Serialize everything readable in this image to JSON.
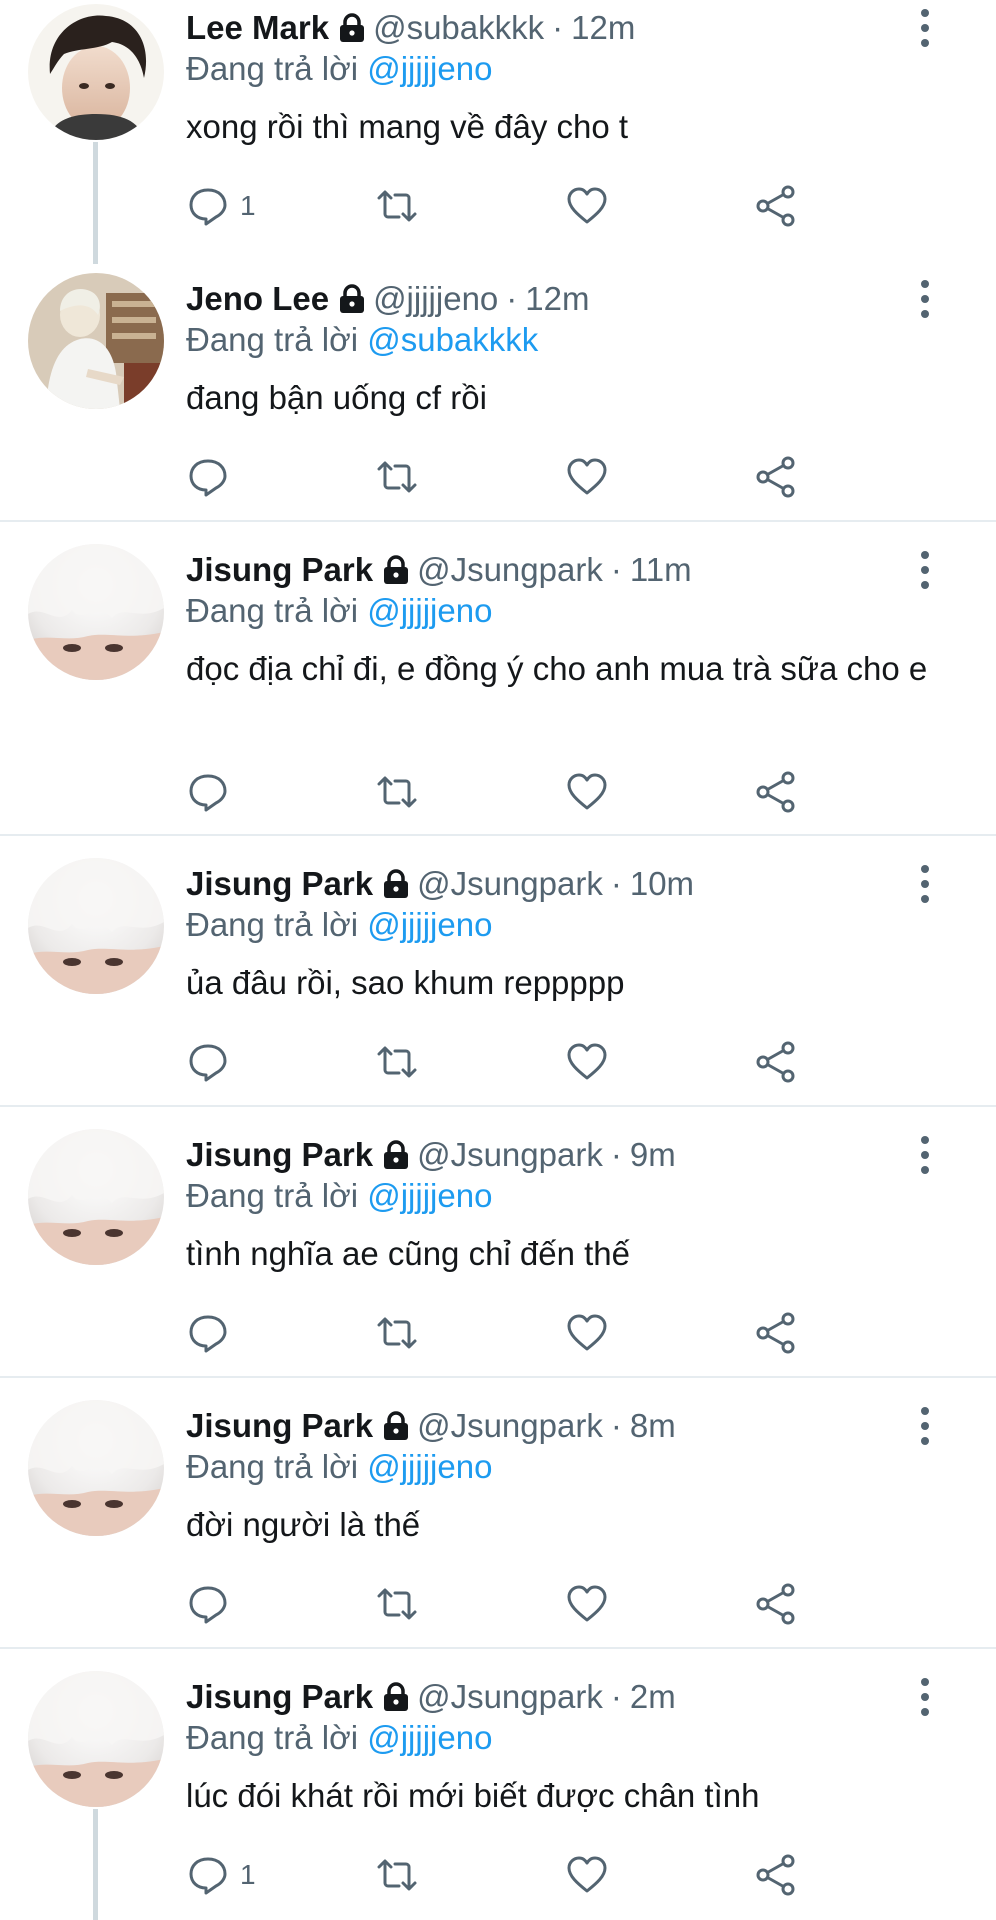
{
  "colors": {
    "accent": "#1d9bf0",
    "muted": "#536471",
    "text": "#14171a",
    "divider": "#e6ecf0",
    "thread_line": "#cfd9de"
  },
  "reply_prefix": "Đang trả lời",
  "icons": {
    "reply": "speech-bubble-icon",
    "retweet": "retweet-arrows-icon",
    "like": "heart-icon",
    "share": "share-nodes-icon",
    "more": "vertical-dots-icon",
    "protected": "lock-icon"
  },
  "tweets": [
    {
      "name": "Lee Mark",
      "handle": "@subakkkk",
      "dot": "·",
      "time": "12m",
      "reply_to": "@jjjjjeno",
      "text": "xong rồi thì mang về đây cho t",
      "reply_count": "1",
      "avatar": "lee-mark"
    },
    {
      "name": "Jeno Lee",
      "handle": "@jjjjjeno",
      "dot": "·",
      "time": "12m",
      "reply_to": "@subakkkk",
      "text": "đang bận uống cf rồi",
      "reply_count": "",
      "avatar": "jeno-lee"
    },
    {
      "name": "Jisung Park",
      "handle": "@Jsungpark",
      "dot": "·",
      "time": "11m",
      "reply_to": "@jjjjjeno",
      "text": "đọc địa chỉ đi, e đồng ý cho anh mua trà sữa cho e",
      "reply_count": "",
      "avatar": "jisung-park"
    },
    {
      "name": "Jisung Park",
      "handle": "@Jsungpark",
      "dot": "·",
      "time": "10m",
      "reply_to": "@jjjjjeno",
      "text": "ủa đâu rồi, sao khum reppppp",
      "reply_count": "",
      "avatar": "jisung-park"
    },
    {
      "name": "Jisung Park",
      "handle": "@Jsungpark",
      "dot": "·",
      "time": "9m",
      "reply_to": "@jjjjjeno",
      "text": "tình nghĩa ae cũng chỉ đến thế",
      "reply_count": "",
      "avatar": "jisung-park"
    },
    {
      "name": "Jisung Park",
      "handle": "@Jsungpark",
      "dot": "·",
      "time": "8m",
      "reply_to": "@jjjjjeno",
      "text": "đời người là thế",
      "reply_count": "",
      "avatar": "jisung-park"
    },
    {
      "name": "Jisung Park",
      "handle": "@Jsungpark",
      "dot": "·",
      "time": "2m",
      "reply_to": "@jjjjjeno",
      "text": "lúc đói khát rồi mới biết được chân tình",
      "reply_count": "1",
      "avatar": "jisung-park"
    }
  ]
}
